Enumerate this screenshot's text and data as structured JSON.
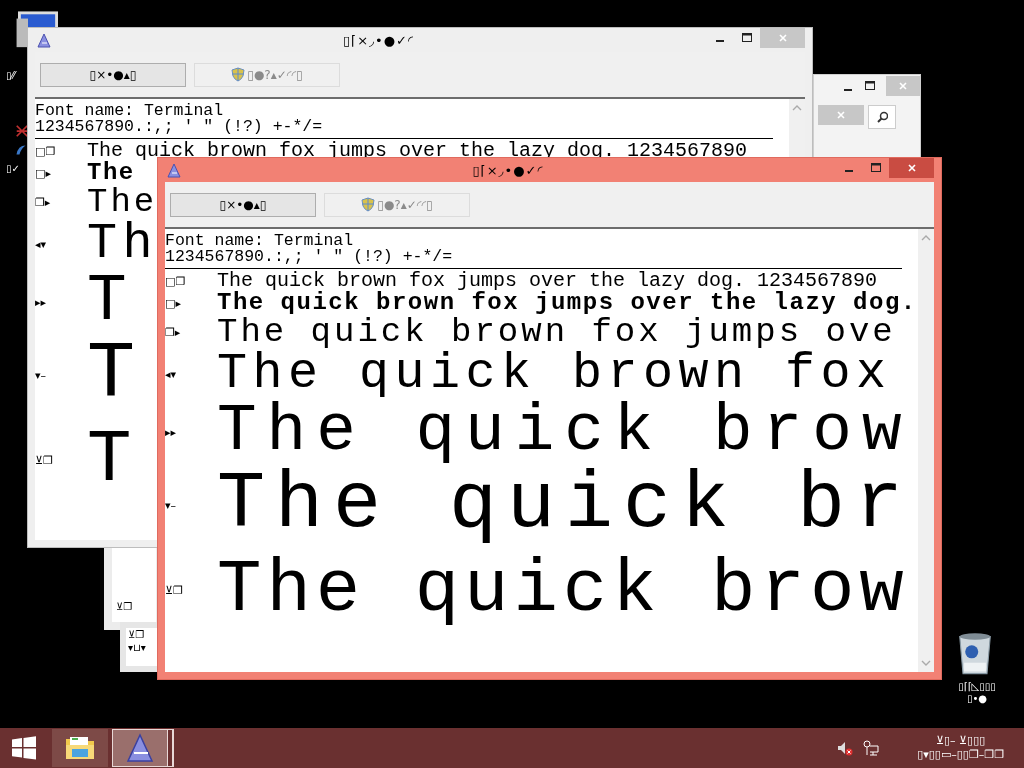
{
  "desktop": {
    "labels": [
      "▯⁄⁄",
      "▯✓"
    ],
    "recycle_bin": {
      "label_lines": [
        "▯⌈⌈◺▯▯▯",
        "▯•●"
      ]
    },
    "background_windows": [
      {
        "kind": "search"
      },
      {
        "kind": "list",
        "marks": [
          "⊻❐"
        ]
      },
      {
        "kind": "list",
        "marks": [
          "⊻❐",
          "▾⊔▾"
        ]
      }
    ]
  },
  "windows": [
    {
      "title": "▯⌈×◞•●✓◜",
      "active": false,
      "scroll_up": true,
      "buttons": [
        {
          "label": "▯×•●▴▯",
          "disabled": false
        },
        {
          "label": "▯●?▴✓◜◜▯",
          "disabled": true
        }
      ],
      "font_name": "Font name: Terminal",
      "charset": "1234567890.:,; ' \" (!?) +-*/=",
      "rows": [
        {
          "marker": "□❐",
          "text": "The quick brown fox jumps over the lazy dog. 1234567890"
        },
        {
          "marker": "□▸",
          "text": "The"
        },
        {
          "marker": "❐▸",
          "text": "The"
        },
        {
          "marker": "◂▾",
          "text": "Th"
        },
        {
          "marker": "▸▸",
          "text": "T"
        },
        {
          "marker": "▾–",
          "text": "T"
        },
        {
          "marker": "⊻❐",
          "text": "T"
        }
      ]
    },
    {
      "title": "▯⌈×◞•●✓◜",
      "active": true,
      "scroll_up": true,
      "scroll_down": true,
      "buttons": [
        {
          "label": "▯×•●▴▯",
          "disabled": false
        },
        {
          "label": "▯●?▴✓◜◜▯",
          "disabled": true
        }
      ],
      "font_name": "Font name: Terminal",
      "charset": "1234567890.:,; ' \" (!?) +-*/=",
      "rows": [
        {
          "marker": "□❐",
          "text": "The quick brown fox jumps over the lazy dog. 1234567890"
        },
        {
          "marker": "□▸",
          "text": "The quick brown fox jumps over the lazy dog."
        },
        {
          "marker": "❐▸",
          "text": "The quick brown fox jumps ove"
        },
        {
          "marker": "◂▾",
          "text": "The quick brown fox"
        },
        {
          "marker": "▸▸",
          "text": "The quick brow"
        },
        {
          "marker": "▾–",
          "text": "The quick br"
        },
        {
          "marker": "⊻❐",
          "text": "The quick brow"
        }
      ]
    }
  ],
  "taskbar": {
    "buttons": [
      {
        "kind": "start"
      },
      {
        "kind": "explorer",
        "selected": false
      },
      {
        "kind": "app",
        "selected": true
      }
    ],
    "clock_lines": [
      "⊻▯– ⊻▯▯▯",
      "▯▾▯▯▭–▯▯❐–❐❐"
    ]
  }
}
